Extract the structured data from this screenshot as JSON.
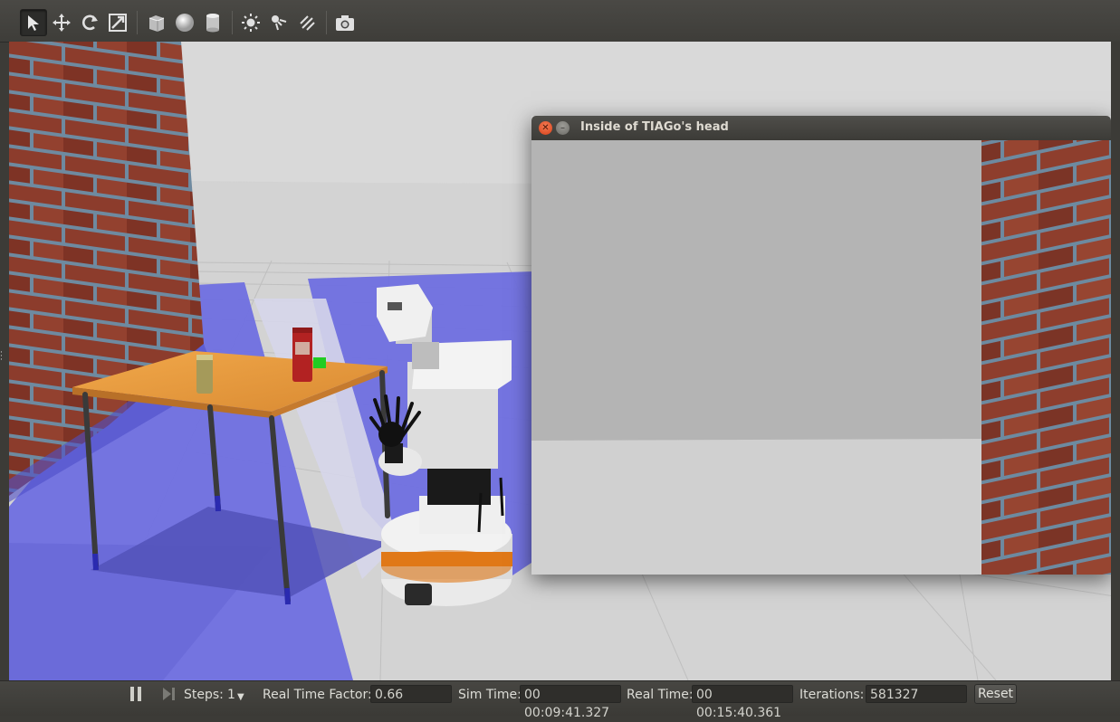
{
  "toolbar": {
    "tools": [
      {
        "name": "select-mode",
        "active": true
      },
      {
        "name": "translate-mode"
      },
      {
        "name": "rotate-mode"
      },
      {
        "name": "scale-mode"
      },
      {
        "name": "box-shape"
      },
      {
        "name": "sphere-shape"
      },
      {
        "name": "cylinder-shape"
      },
      {
        "name": "point-light"
      },
      {
        "name": "spot-light"
      },
      {
        "name": "directional-light"
      },
      {
        "name": "screenshot"
      }
    ]
  },
  "camera_window": {
    "title": "Inside of TIAGo's head"
  },
  "statusbar": {
    "steps_label": "Steps:",
    "steps_value": "1",
    "rtf_label": "Real Time Factor:",
    "rtf_value": "0.66",
    "sim_time_label": "Sim Time:",
    "sim_time_value": "00 00:09:41.327",
    "real_time_label": "Real Time:",
    "real_time_value": "00 00:15:40.361",
    "iterations_label": "Iterations:",
    "iterations_value": "581327",
    "reset_label": "Reset"
  },
  "colors": {
    "floor_overlay": "#6f6fe0",
    "brick": "#8a3a2a",
    "mortar": "#6f8aa0",
    "table_top": "#e89a3c",
    "robot_orange": "#e07818"
  }
}
